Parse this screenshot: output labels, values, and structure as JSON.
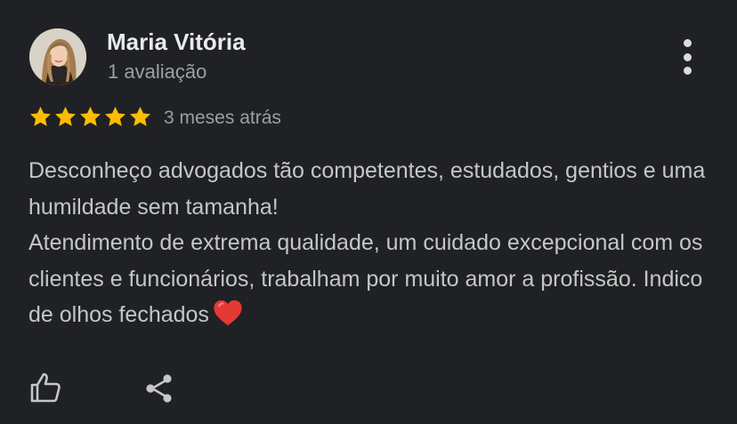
{
  "reviewer": {
    "name": "Maria Vitória",
    "review_count": "1 avaliação"
  },
  "rating": {
    "stars": 5,
    "max": 5,
    "date": "3 meses atrás"
  },
  "review": {
    "paragraph_1": "Desconheço advogados tão competentes, estudados, gentios e uma humildade sem tamanha!",
    "paragraph_2": "Atendimento de extrema qualidade, um cuidado excepcional com os clientes e funcionários, trabalham por muito amor a profissão. Indico de olhos fechados"
  },
  "icons": {
    "menu": "more-vert-icon",
    "like": "thumbs-up-icon",
    "share": "share-icon",
    "star": "star-icon",
    "heart": "heart-icon"
  },
  "colors": {
    "background": "#202124",
    "star": "#fbbc04",
    "heart": "#e53935",
    "text_primary": "#e8eaed",
    "text_secondary": "#9aa0a6"
  }
}
